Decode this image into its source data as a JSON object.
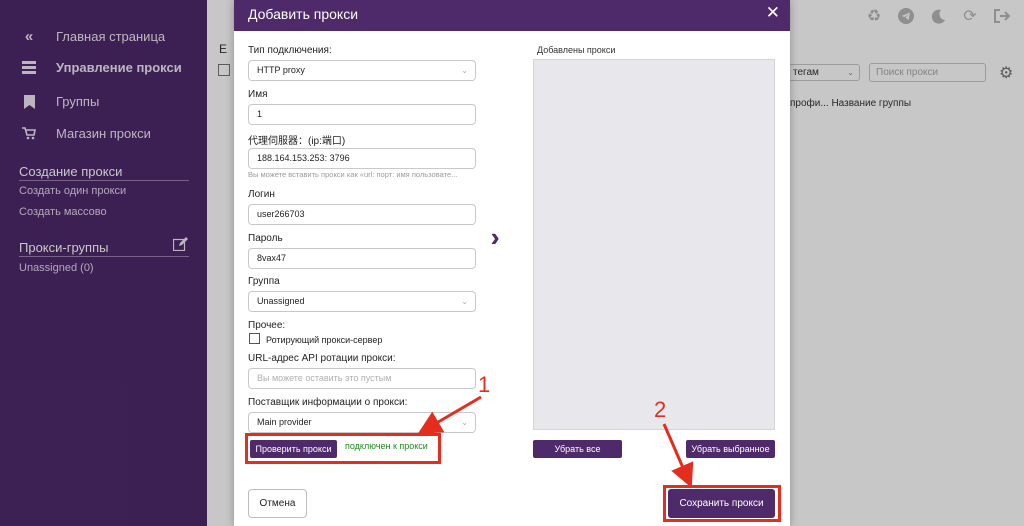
{
  "sidebar": {
    "collapse_icon": "double-chevron-left-icon",
    "items": [
      {
        "label": "Главная страница",
        "icon": "chevron-double-left-icon"
      },
      {
        "label": "Управление прокси",
        "icon": "server-icon"
      },
      {
        "label": "Группы",
        "icon": "bookmark-icon"
      },
      {
        "label": "Магазин прокси",
        "icon": "cart-icon"
      }
    ],
    "create_section": {
      "title": "Создание прокси",
      "links": [
        "Создать один прокси",
        "Создать массово"
      ]
    },
    "groups_section": {
      "title": "Прокси-группы",
      "items": [
        "Unassigned (0)"
      ]
    }
  },
  "main": {
    "tag_filter_value": "тегам",
    "search_placeholder": "Поиск прокси",
    "col_header": "профи... Название группы",
    "partial_label": "Е"
  },
  "modal": {
    "title": "Добавить прокси",
    "close": "✕",
    "fields": {
      "type_label": "Тип подключения:",
      "type_value": "HTTP proxy",
      "name_label": "Имя",
      "name_value": "1",
      "server_label": "代理伺服器：(ip:端口)",
      "server_value": "188.164.153.253: 3796",
      "server_hint": "Вы можете вставить прокси как «url: порт: имя пользовате...",
      "login_label": "Логин",
      "login_value": "user266703",
      "password_label": "Пароль",
      "password_value": "8vax47",
      "group_label": "Группа",
      "group_value": "Unassigned",
      "other_label": "Прочее:",
      "rotating_label": "Ротирующий прокси-сервер",
      "rotation_url_label": "URL-адрес API ротации прокси:",
      "rotation_url_placeholder": "Вы можете оставить это пустым",
      "provider_label": "Поставщик информации о прокси:",
      "provider_value": "Main provider"
    },
    "check_button": "Проверить прокси",
    "check_status": "подключен к прокси",
    "added_label": "Добавлены прокси",
    "remove_all_button": "Убрать все",
    "remove_selected_button": "Убрать выбранное",
    "cancel_button": "Отмена",
    "save_button": "Сохранить прокси"
  },
  "annotations": {
    "step1": "1",
    "step2": "2"
  },
  "colors": {
    "accent": "#4e2a6b",
    "success": "#1e8c1e",
    "annotation": "#e52d1f"
  }
}
